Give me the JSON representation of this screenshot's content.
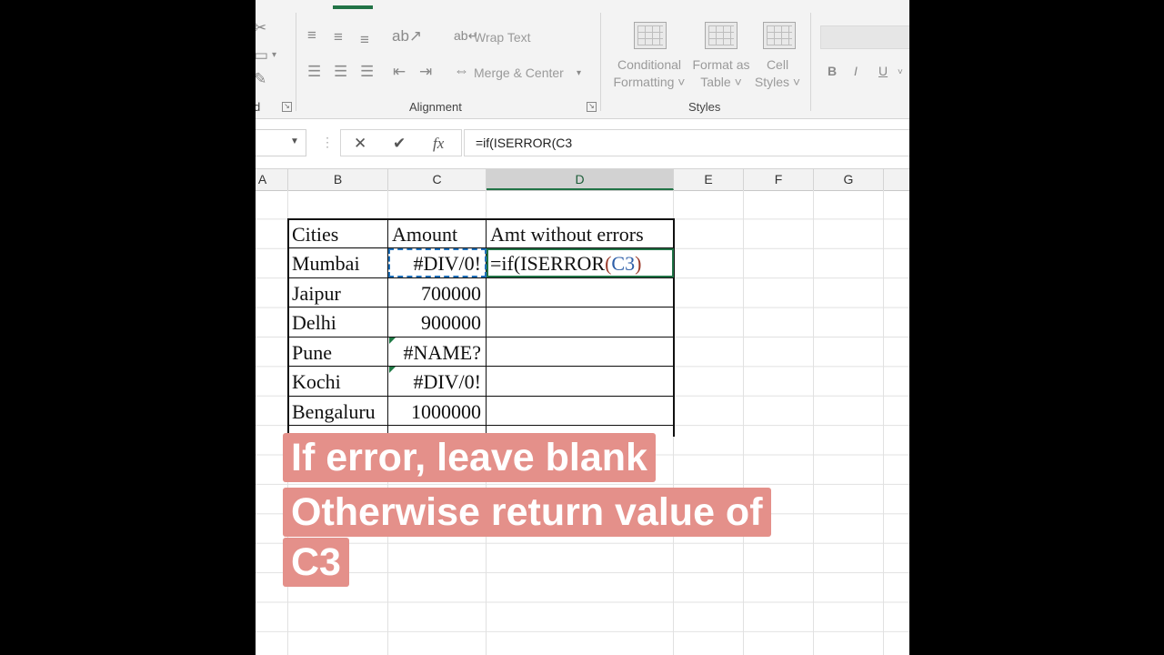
{
  "ribbon": {
    "wrap_text": "Wrap Text",
    "merge_center": "Merge & Center",
    "alignment_label": "Alignment",
    "conditional_formatting": [
      "Conditional",
      "Formatting ˅"
    ],
    "format_as_table": [
      "Format as",
      "Table ˅"
    ],
    "cell_styles": [
      "Cell",
      "Styles ˅"
    ],
    "styles_label": "Styles",
    "clipboard_label_fragment": "d",
    "font_bold": "B",
    "font_italic": "I",
    "font_underline": "U"
  },
  "formula_bar": {
    "cancel": "✕",
    "enter": "✔",
    "fx": "fx",
    "formula": "=if(ISERROR(C3"
  },
  "columns": [
    "A",
    "B",
    "C",
    "D",
    "E",
    "F",
    "G"
  ],
  "active_column": "D",
  "table": {
    "headers": [
      "Cities",
      "Amount",
      "Amt without errors"
    ],
    "rows": [
      {
        "city": "Mumbai",
        "amount": "#DIV/0!"
      },
      {
        "city": "Jaipur",
        "amount": "700000"
      },
      {
        "city": "Delhi",
        "amount": "900000"
      },
      {
        "city": "Pune",
        "amount": "#NAME?"
      },
      {
        "city": "Kochi",
        "amount": "#DIV/0!"
      },
      {
        "city": "Bengaluru",
        "amount": "1000000"
      }
    ],
    "editing_cell": {
      "prefix": "=if(ISERROR",
      "open_paren": "(",
      "ref": "C3",
      "close_paren": ")"
    }
  },
  "caption": {
    "line1": "If error, leave blank",
    "line2": "Otherwise return value of",
    "line3": "C3"
  },
  "colors": {
    "accent": "#217346",
    "caption_bg": "#e4908a",
    "copy_border": "#1e6fb8"
  }
}
